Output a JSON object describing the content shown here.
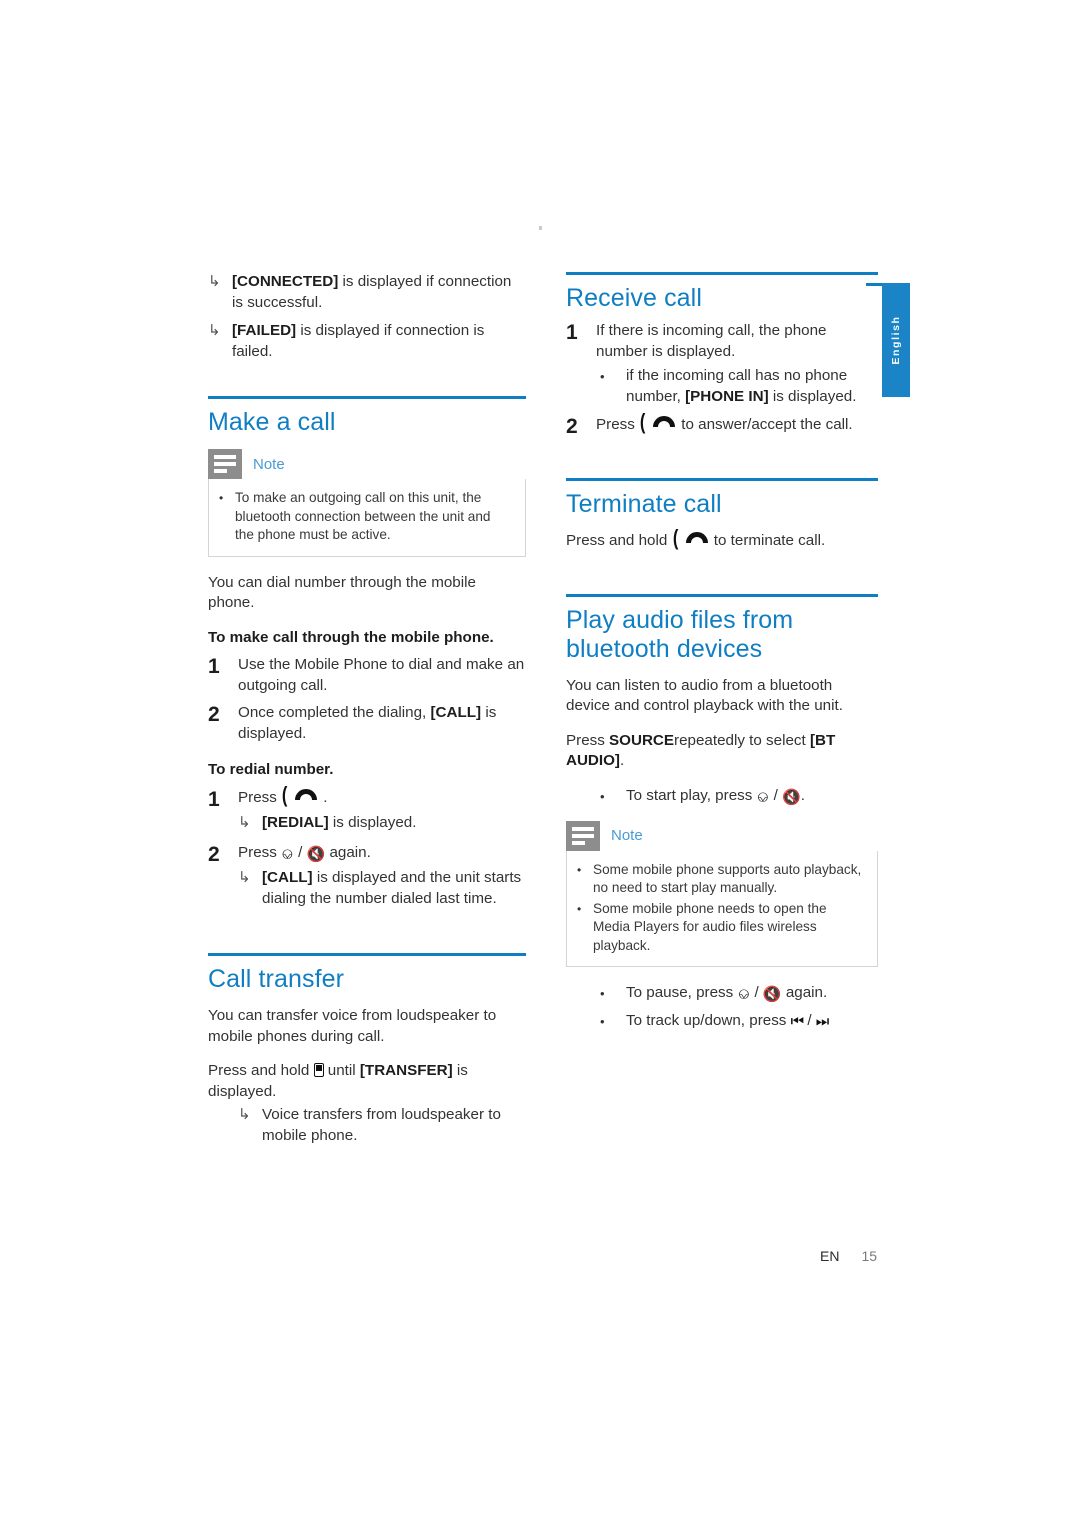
{
  "document": {
    "language_tab": "English",
    "footer": {
      "lang_code": "EN",
      "page_number": "15"
    },
    "accent_color": "#0f7ec2",
    "note_badge_color": "#8d8d8d"
  },
  "left_column": {
    "intro_arrows": [
      {
        "glyph": "arrow-hook-icon",
        "bold": "[CONNECTED]",
        "text": " is displayed if connection is successful."
      },
      {
        "glyph": "arrow-hook-icon",
        "bold": "[FAILED]",
        "text": " is displayed if connection is failed."
      }
    ],
    "make_a_call": {
      "heading": "Make a call",
      "note": {
        "title": "Note",
        "items": [
          "To make an outgoing call on this unit, the bluetooth connection between the unit and the phone must be active."
        ]
      },
      "intro": "You can dial number through the mobile phone.",
      "subhead_1": "To make call through the mobile phone.",
      "steps_1": [
        {
          "num": "1",
          "text": "Use the Mobile Phone to dial and make an outgoing call."
        },
        {
          "num": "2",
          "text_pre": "Once completed the dialing, ",
          "bold": "[CALL]",
          "text_post": " is displayed."
        }
      ],
      "subhead_2": "To redial number.",
      "steps_2": [
        {
          "num": "1",
          "text_pre": "Press ",
          "icon": "phone-call-icon",
          "text_post": " .",
          "sub_arrow": {
            "bold": "[REDIAL]",
            "text": " is displayed."
          }
        },
        {
          "num": "2",
          "text_pre": "Press ",
          "icon_power": "power-icon",
          "separator": " / ",
          "icon_mute": "mute-icon",
          "text_post": " again.",
          "sub_arrow": {
            "bold": "[CALL]",
            "text": " is displayed and the unit starts dialing the number dialed last time."
          }
        }
      ]
    },
    "call_transfer": {
      "heading": "Call transfer",
      "intro": "You can transfer voice from loudspeaker to mobile phones during call.",
      "instruction_pre": "Press and hold ",
      "instruction_icon": "mobile-phone-icon",
      "instruction_mid": " until ",
      "instruction_bold": "[TRANSFER]",
      "instruction_post": " is displayed.",
      "result_arrow": "Voice transfers from loudspeaker to mobile phone."
    }
  },
  "right_column": {
    "receive_call": {
      "heading": "Receive call",
      "steps": [
        {
          "num": "1",
          "text": "If there is incoming call, the phone number is displayed.",
          "sub_bullet_pre": "if the incoming call has no phone number, ",
          "sub_bullet_bold": "[PHONE IN]",
          "sub_bullet_post": " is displayed."
        },
        {
          "num": "2",
          "text_pre": "Press ",
          "icon": "phone-call-icon",
          "text_post": " to answer/accept the call."
        }
      ]
    },
    "terminate_call": {
      "heading": "Terminate call",
      "text_pre": "Press and hold ",
      "icon": "phone-call-icon",
      "text_post": " to terminate call."
    },
    "play_audio": {
      "heading_line_1": "Play audio files from",
      "heading_line_2": "bluetooth devices",
      "intro": "You can listen to audio from a bluetooth device and control playback with the unit.",
      "source_pre": "Press ",
      "source_bold": "SOURCE",
      "source_mid": "repeatedly to select ",
      "source_bold_2": "[BT AUDIO]",
      "source_post": ".",
      "start_play_pre": "To start play, press ",
      "start_play_power": "power-icon",
      "start_play_sep": " / ",
      "start_play_mute": "mute-icon",
      "start_play_post": ".",
      "note": {
        "title": "Note",
        "items": [
          "Some mobile phone supports auto playback, no need to start play manually.",
          "Some mobile phone needs to open the Media Players for audio files wireless playback."
        ]
      },
      "pause_pre": "To pause, press ",
      "pause_power": "power-icon",
      "pause_sep": " / ",
      "pause_mute": "mute-icon",
      "pause_post": " again.",
      "track_pre": "To track up/down, press ",
      "track_prev": "previous-track-icon",
      "track_sep": " / ",
      "track_next": "next-track-icon"
    }
  }
}
